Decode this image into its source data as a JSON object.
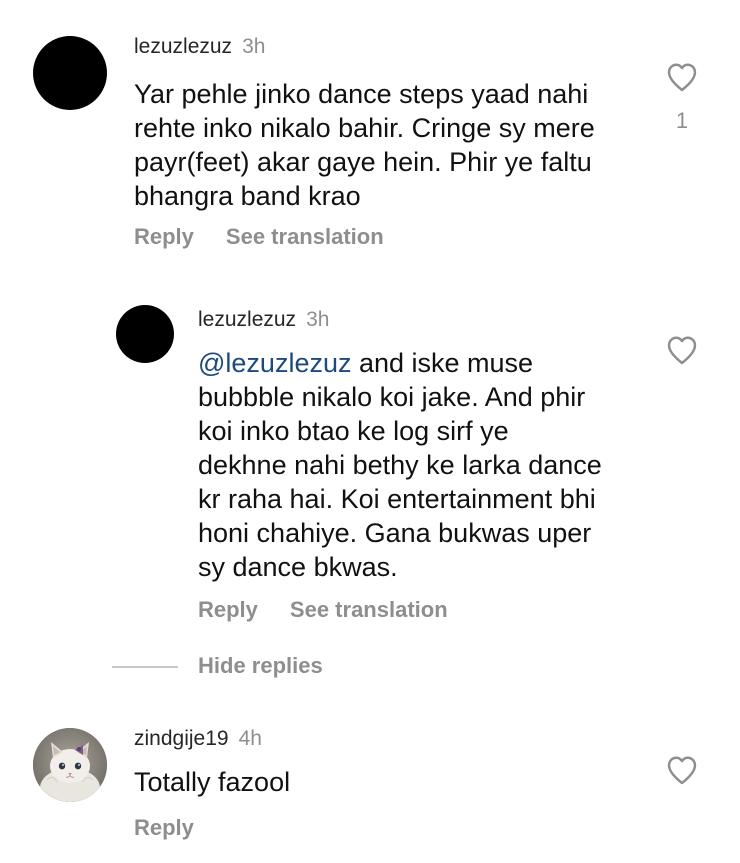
{
  "comments": [
    {
      "username": "lezuzlezuz",
      "time": "3h",
      "text_lines": [
        "Yar pehle jinko dance steps yaad nahi",
        "rehte inko nikalo bahir. Cringe sy mere",
        "payr(feet) akar gaye hein. Phir ye faltu",
        "bhangra band krao"
      ],
      "reply_label": "Reply",
      "translate_label": "See translation",
      "like_count": "1"
    },
    {
      "username": "lezuzlezuz",
      "time": "3h",
      "mention": "@lezuzlezuz",
      "first_line_rest": " and iske muse",
      "text_lines": [
        "bubbble nikalo koi jake. And phir",
        "koi inko btao ke log sirf ye",
        "dekhne nahi bethy ke larka dance",
        "kr raha hai. Koi entertainment bhi",
        "honi chahiye. Gana bukwas uper",
        "sy dance bkwas."
      ],
      "reply_label": "Reply",
      "translate_label": "See translation"
    },
    {
      "username": "zindgije19",
      "time": "4h",
      "text": "Totally fazool",
      "reply_label": "Reply"
    }
  ],
  "hide_replies_label": "Hide replies",
  "icons": {
    "like": "heart-outline-icon",
    "avatar_default": "black-circle-avatar",
    "avatar_cat": "kitten-photo-avatar"
  },
  "colors": {
    "text": "#111111",
    "muted": "#8e8e8e",
    "mention": "#1c4a7e",
    "divider": "#c7c7c7"
  }
}
